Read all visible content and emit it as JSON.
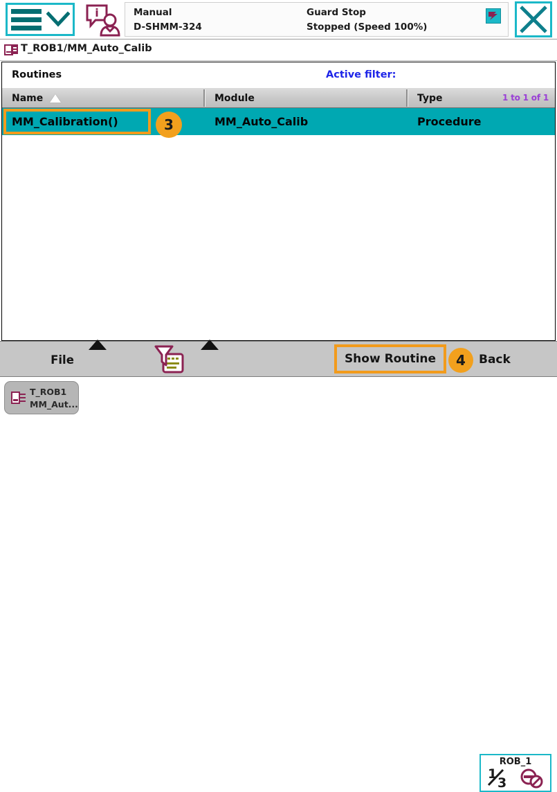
{
  "header": {
    "menu_icon": "hamburger-menu-icon",
    "menu_chevron_icon": "chevron-down-icon",
    "operator_icon": "operator-info-icon",
    "mode_label": "Manual",
    "controller_name": "D-SHMM-324",
    "guard_state": "Guard Stop",
    "run_state": "Stopped (Speed 100%)",
    "status_icon": "execution-status-icon",
    "close_icon": "close-icon",
    "accent_cyan": "#1bb8c8"
  },
  "breadcrumb": {
    "icon": "program-module-icon",
    "path": "T_ROB1/MM_Auto_Calib"
  },
  "panel": {
    "title": "Routines",
    "active_filter_label": "Active filter:",
    "active_filter_value": "",
    "filter_color": "#1e25e8"
  },
  "table": {
    "columns": [
      {
        "label": "Name",
        "sort_icon": "sort-ascending-icon"
      },
      {
        "label": "Module",
        "sort_icon": ""
      },
      {
        "label": "Type",
        "sort_icon": ""
      }
    ],
    "pager": "1 to 1 of 1",
    "pager_color": "#9a3fd6",
    "selected_row_color": "#00a8b2",
    "rows": [
      {
        "name": "MM_Calibration()",
        "module": "MM_Auto_Calib",
        "type": "Procedure",
        "selected": true
      }
    ]
  },
  "annotations": {
    "step_3": "3",
    "step_4": "4",
    "highlight_color": "#f29b1c"
  },
  "toolbar": {
    "file_label": "File",
    "file_caret_icon": "caret-up-icon",
    "filter_icon": "filter-document-icon",
    "filter_caret_icon": "caret-up-icon",
    "show_routine_label": "Show Routine",
    "back_label": "Back"
  },
  "taskbar": {
    "task_icon": "program-editor-icon",
    "task_line1": "T_ROB1",
    "task_line2": "MM_Aut...",
    "robot_label": "ROB_1",
    "robot_numerator": "1",
    "robot_denominator": "3",
    "robot_icon": "motors-off-icon"
  }
}
